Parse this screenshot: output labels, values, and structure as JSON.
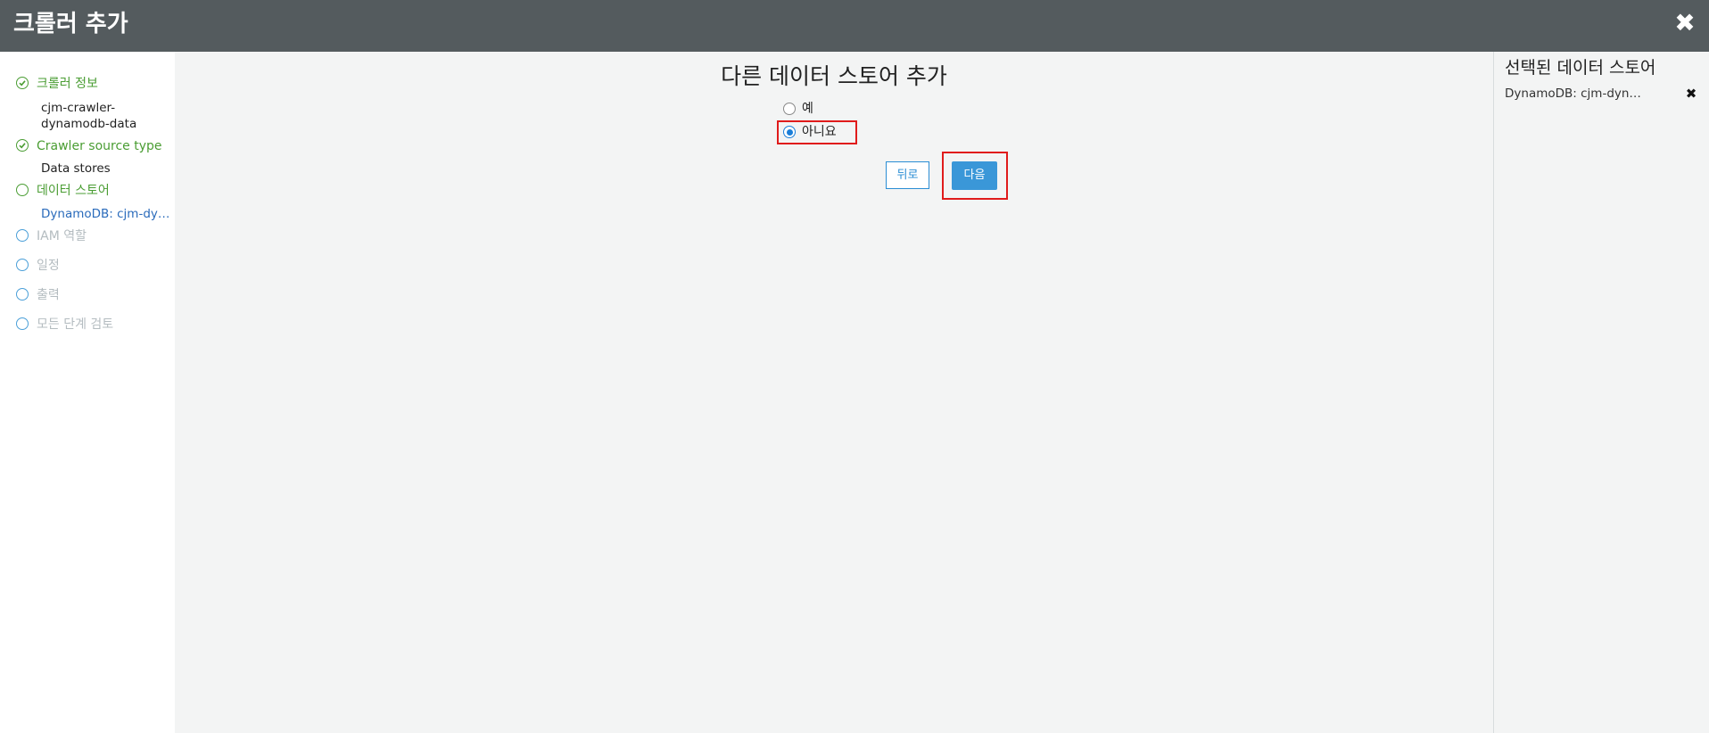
{
  "window": {
    "title": "크롤러 추가",
    "close_icon": "✖"
  },
  "sidebar": {
    "steps": [
      {
        "label": "크롤러 정보",
        "sub": [
          "cjm-crawler-",
          "dynamodb-data"
        ],
        "state": "done"
      },
      {
        "label": "Crawler source type",
        "sub": [
          "Data stores"
        ],
        "state": "done"
      },
      {
        "label": "데이터 스토어",
        "sub": [
          "DynamoDB: cjm-dy…"
        ],
        "state": "current"
      },
      {
        "label": "IAM 역할",
        "state": "todo"
      },
      {
        "label": "일정",
        "state": "todo"
      },
      {
        "label": "출력",
        "state": "todo"
      },
      {
        "label": "모든 단계 검토",
        "state": "todo"
      }
    ]
  },
  "main": {
    "heading": "다른 데이터 스토어 추가",
    "options": [
      {
        "label": "예",
        "checked": false
      },
      {
        "label": "아니요",
        "checked": true
      }
    ],
    "back_label": "뒤로",
    "next_label": "다음"
  },
  "right_panel": {
    "title": "선택된 데이터 스토어",
    "item": "DynamoDB: cjm-dyn…",
    "remove_icon": "✖"
  },
  "colors": {
    "titlebar": "#545b5e",
    "done": "#4a9d33",
    "todo_circle": "#4a9fd8",
    "primary_button": "#3a97d8",
    "highlight": "#e01b1b"
  }
}
